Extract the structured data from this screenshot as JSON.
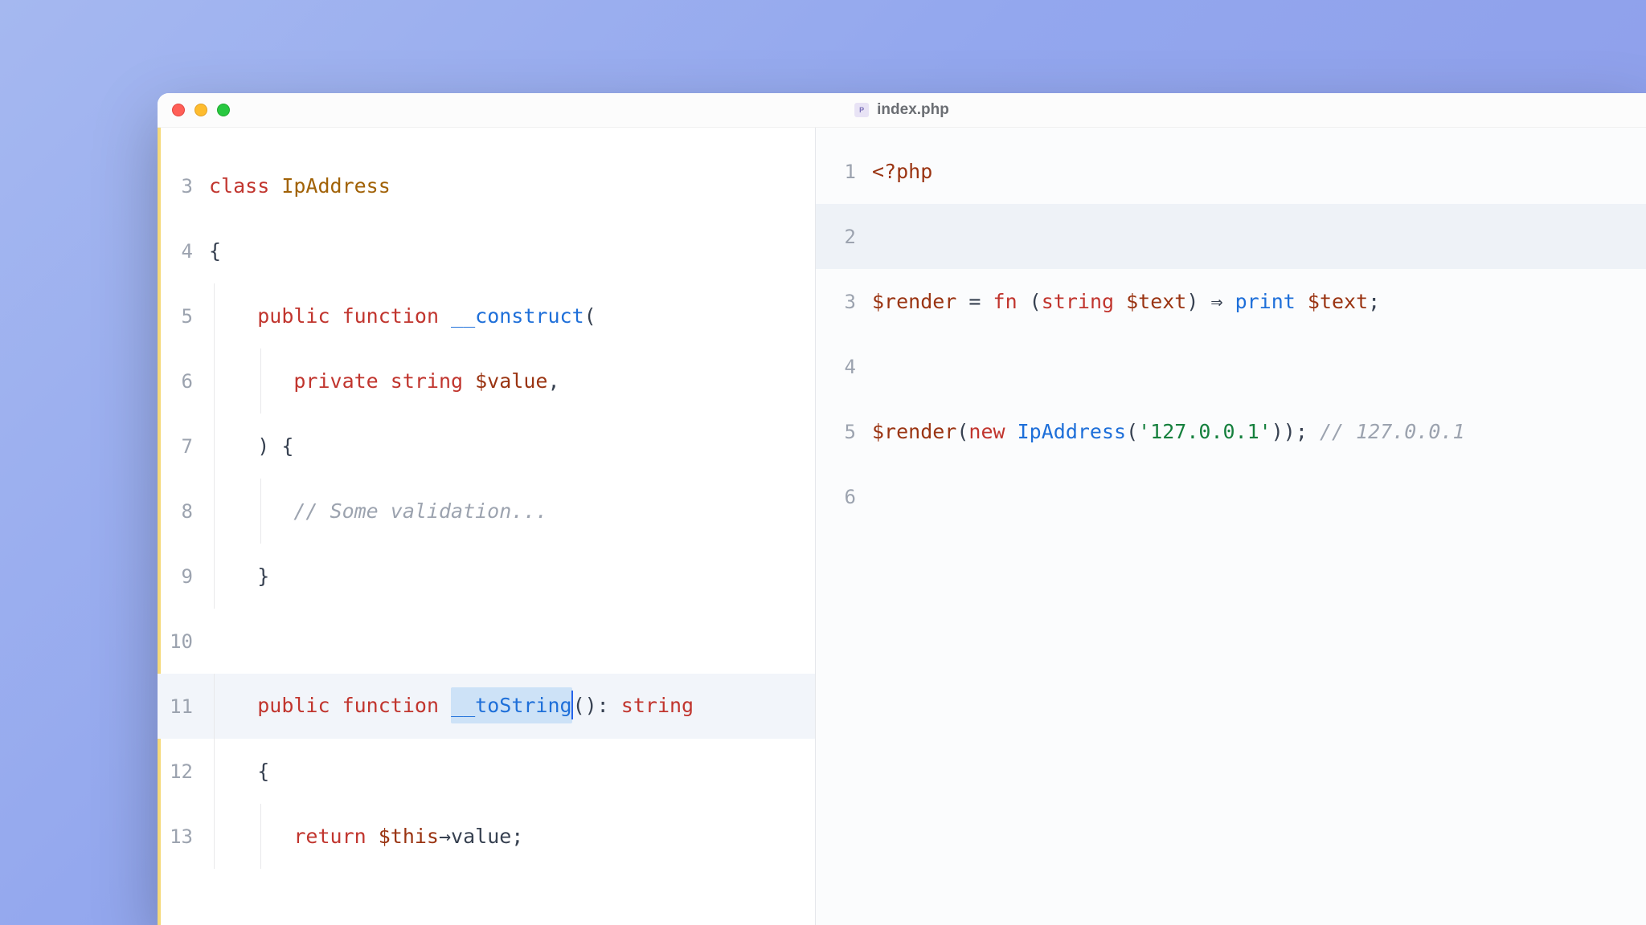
{
  "window": {
    "title": "index.php",
    "file_icon": "php"
  },
  "left_pane": {
    "lines": [
      {
        "num": "3",
        "indent": 0
      },
      {
        "num": "4",
        "indent": 0
      },
      {
        "num": "5",
        "indent": 1
      },
      {
        "num": "6",
        "indent": 2
      },
      {
        "num": "7",
        "indent": 1
      },
      {
        "num": "8",
        "indent": 2
      },
      {
        "num": "9",
        "indent": 1
      },
      {
        "num": "10",
        "indent": 0
      },
      {
        "num": "11",
        "indent": 1,
        "highlighted": true
      },
      {
        "num": "12",
        "indent": 1
      },
      {
        "num": "13",
        "indent": 2
      }
    ],
    "tokens": {
      "l3_class": "class",
      "l3_name": " IpAddress",
      "l4_brace": "{",
      "l5_public": "public",
      "l5_function": " function",
      "l5_construct": " __construct",
      "l5_paren": "(",
      "l6_private": "private",
      "l6_string": " string",
      "l6_var": " $value",
      "l6_comma": ",",
      "l7_close": ") {",
      "l8_comment": "// Some validation...",
      "l9_brace": "}",
      "l11_public": "public",
      "l11_function": " function",
      "l11_space": " ",
      "l11_toString": "__toString",
      "l11_paren": "():",
      "l11_ret": " string",
      "l12_brace": "{",
      "l13_return": "return",
      "l13_this": " $this",
      "l13_arrow": "→",
      "l13_value": "value;"
    }
  },
  "right_pane": {
    "lines": [
      {
        "num": "1"
      },
      {
        "num": "2",
        "highlighted": true
      },
      {
        "num": "3"
      },
      {
        "num": "4"
      },
      {
        "num": "5"
      },
      {
        "num": "6"
      }
    ],
    "tokens": {
      "l1_php": "<?php",
      "l3_var": "$render",
      "l3_eq": " = ",
      "l3_fn": "fn",
      "l3_open": " (",
      "l3_type": "string",
      "l3_param": " $text",
      "l3_close": ") ",
      "l3_arrow": "⇒",
      "l3_print": " print",
      "l3_arg": " $text",
      "l3_semi": ";",
      "l5_var": "$render",
      "l5_open": "(",
      "l5_new": "new",
      "l5_class": " IpAddress",
      "l5_popen": "(",
      "l5_str": "'127.0.0.1'",
      "l5_close": "));",
      "l5_comment": " // 127.0.0.1"
    }
  }
}
